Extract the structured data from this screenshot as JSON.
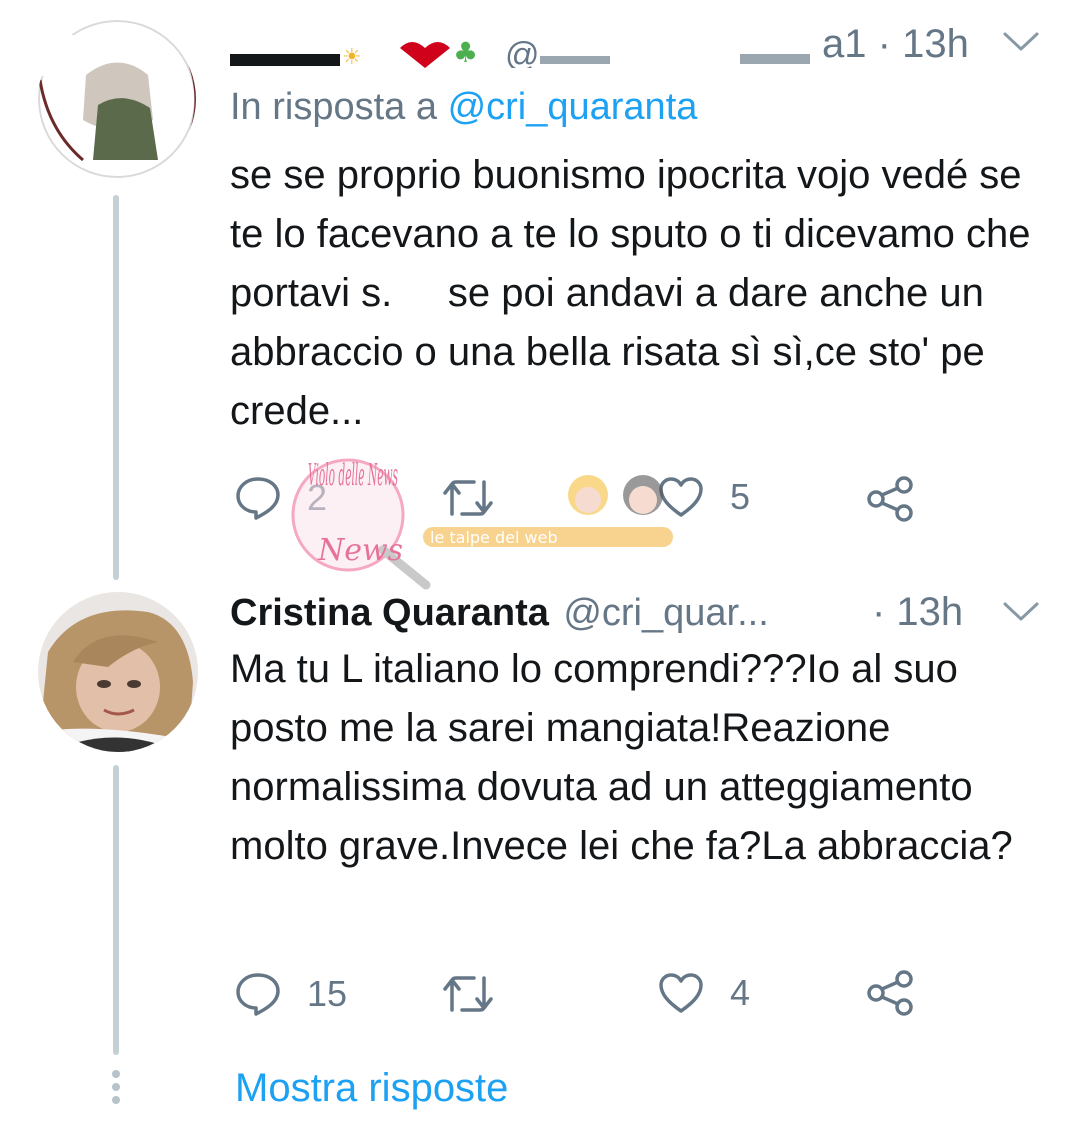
{
  "tweet1": {
    "handle_tail": "a1",
    "time": "13h",
    "reply_prefix": "In risposta a",
    "reply_mention": "@cri_quaranta",
    "text": "se se proprio buonismo ipocrita vojo vedé se te lo facevano a te lo sputo o ti dicevamo che portavi s.     se poi andavi a dare anche un abbraccio o una bella risata sì sì,ce sto' pe crede...",
    "reply_count": "2",
    "retweet_count": "",
    "like_count": "5"
  },
  "tweet2": {
    "name": "Cristina Quaranta",
    "handle": "@cri_quar...",
    "time": "· 13h",
    "text": "Ma tu L italiano lo comprendi???Io al suo posto me la sarei mangiata!Reazione normalissima dovuta ad un atteggiamento molto grave.Invece lei che fa?La abbraccia?",
    "reply_count": "15",
    "retweet_count": "",
    "like_count": "4"
  },
  "show_replies": "Mostra risposte",
  "watermark": {
    "logo_text": "Violo delle News",
    "banner_text": "le talpe del web"
  },
  "colors": {
    "link": "#1da1f2",
    "secondary": "#657786",
    "thread_line": "#c4cfd6",
    "text": "#14171a"
  },
  "icons": [
    "reply-icon",
    "retweet-icon",
    "like-icon",
    "share-icon",
    "chevron-down-icon"
  ]
}
